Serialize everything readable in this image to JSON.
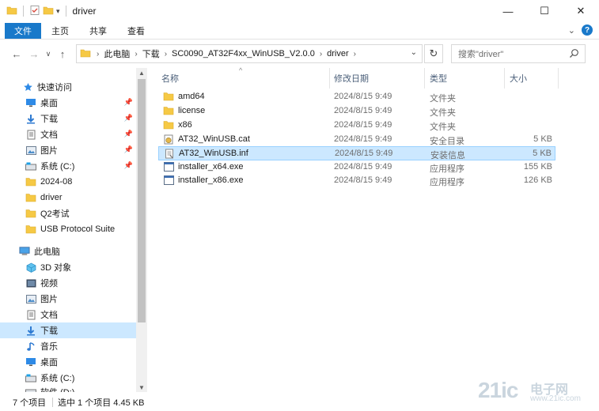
{
  "window": {
    "title": "driver",
    "controls": {
      "minimize": "—",
      "maximize": "☐",
      "close": "✕"
    }
  },
  "ribbon": {
    "tabs": [
      "文件",
      "主页",
      "共享",
      "查看"
    ],
    "help": "?"
  },
  "navigation": {
    "back": "←",
    "forward": "→",
    "recent": "∨",
    "up": "↑",
    "breadcrumb": [
      "此电脑",
      "下载",
      "SC0090_AT32F4xx_WinUSB_V2.0.0",
      "driver"
    ],
    "refresh": "↻",
    "search_placeholder": "搜索\"driver\""
  },
  "sidebar": {
    "quick_access": "快速访问",
    "items": [
      {
        "label": "桌面",
        "icon": "desktop-icon",
        "pinned": true
      },
      {
        "label": "下载",
        "icon": "download-icon",
        "pinned": true
      },
      {
        "label": "文档",
        "icon": "documents-icon",
        "pinned": true
      },
      {
        "label": "图片",
        "icon": "pictures-icon",
        "pinned": true
      },
      {
        "label": "系统 (C:)",
        "icon": "drive-icon",
        "pinned": true
      },
      {
        "label": "2024-08",
        "icon": "folder-icon",
        "pinned": false
      },
      {
        "label": "driver",
        "icon": "folder-icon",
        "pinned": false
      },
      {
        "label": "Q2考试",
        "icon": "folder-icon",
        "pinned": false
      },
      {
        "label": "USB Protocol Suite",
        "icon": "folder-icon",
        "pinned": false
      }
    ],
    "this_pc": "此电脑",
    "pc_items": [
      {
        "label": "3D 对象",
        "icon": "3d-objects-icon"
      },
      {
        "label": "视频",
        "icon": "videos-icon"
      },
      {
        "label": "图片",
        "icon": "pictures-icon"
      },
      {
        "label": "文档",
        "icon": "documents-icon"
      },
      {
        "label": "下载",
        "icon": "download-icon",
        "selected": true
      },
      {
        "label": "音乐",
        "icon": "music-icon"
      },
      {
        "label": "桌面",
        "icon": "desktop-icon"
      },
      {
        "label": "系统 (C:)",
        "icon": "drive-icon"
      },
      {
        "label": "软件 (D:)",
        "icon": "drive-icon"
      }
    ]
  },
  "columns": {
    "name": "名称",
    "date": "修改日期",
    "type": "类型",
    "size": "大小"
  },
  "files": [
    {
      "name": "amd64",
      "date": "2024/8/15 9:49",
      "type": "文件夹",
      "size": "",
      "icon": "folder-icon"
    },
    {
      "name": "license",
      "date": "2024/8/15 9:49",
      "type": "文件夹",
      "size": "",
      "icon": "folder-icon"
    },
    {
      "name": "x86",
      "date": "2024/8/15 9:49",
      "type": "文件夹",
      "size": "",
      "icon": "folder-icon"
    },
    {
      "name": "AT32_WinUSB.cat",
      "date": "2024/8/15 9:49",
      "type": "安全目录",
      "size": "5 KB",
      "icon": "security-catalog-icon"
    },
    {
      "name": "AT32_WinUSB.inf",
      "date": "2024/8/15 9:49",
      "type": "安装信息",
      "size": "5 KB",
      "icon": "setup-info-icon",
      "selected": true
    },
    {
      "name": "installer_x64.exe",
      "date": "2024/8/15 9:49",
      "type": "应用程序",
      "size": "155 KB",
      "icon": "application-icon"
    },
    {
      "name": "installer_x86.exe",
      "date": "2024/8/15 9:49",
      "type": "应用程序",
      "size": "126 KB",
      "icon": "application-icon"
    }
  ],
  "status": {
    "item_count": "7 个项目",
    "selection": "选中 1 个项目  4.45 KB"
  },
  "watermark": {
    "text": "21ic",
    "cn": "电子网",
    "com": "www.21ic.com"
  },
  "colors": {
    "accent": "#1979ca",
    "selection": "#cce8ff",
    "selection_border": "#99d1ff",
    "folder": "#f6c945",
    "header_text": "#4c607a"
  }
}
